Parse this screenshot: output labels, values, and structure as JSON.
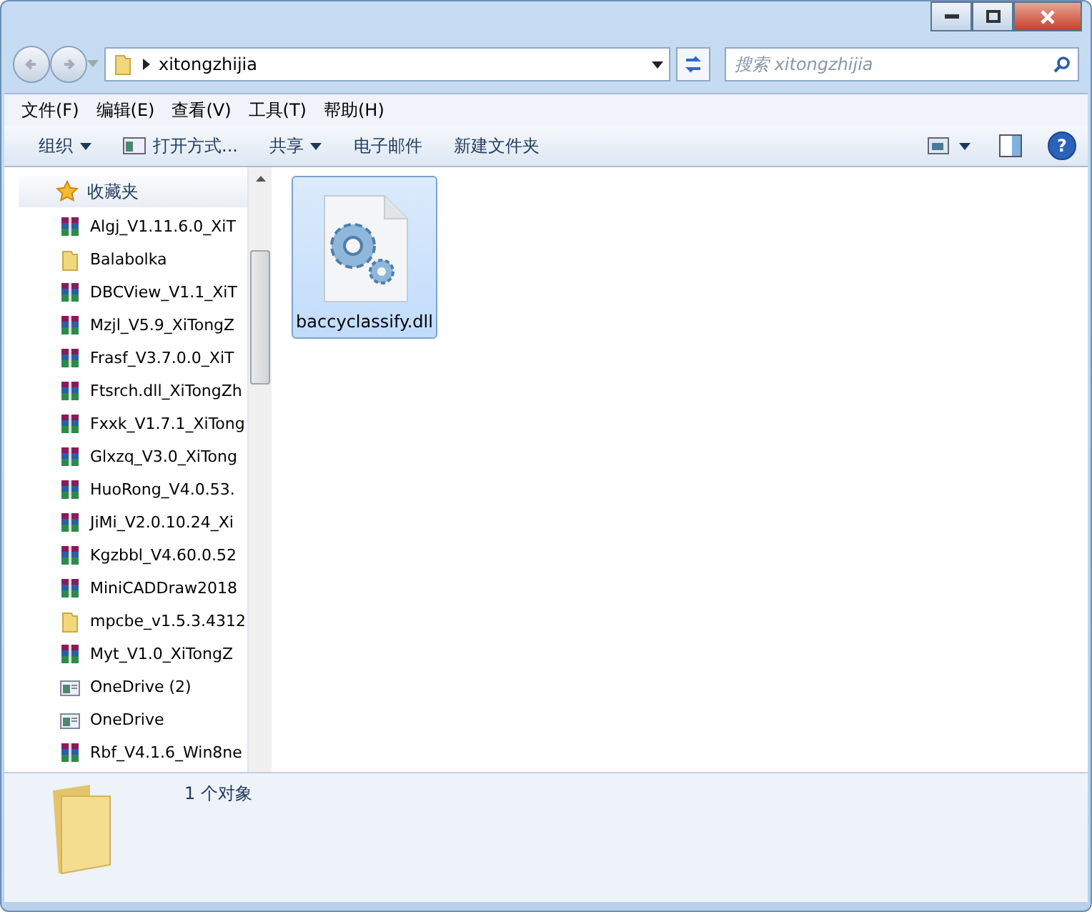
{
  "address_bar": {
    "path": "xitongzhijia"
  },
  "search": {
    "placeholder": "搜索 xitongzhijia"
  },
  "menu_bar": [
    "文件(F)",
    "编辑(E)",
    "查看(V)",
    "工具(T)",
    "帮助(H)"
  ],
  "toolbar": [
    {
      "label": "组织",
      "kind": "dropdown"
    },
    {
      "label": "打开方式...",
      "kind": "icon"
    },
    {
      "label": "共享",
      "kind": "dropdown"
    },
    {
      "label": "电子邮件",
      "kind": "plain"
    },
    {
      "label": "新建文件夹",
      "kind": "plain"
    }
  ],
  "sidebar": {
    "header": "收藏夹",
    "items": [
      {
        "label": "Algj_V1.11.6.0_XiT",
        "kind": "archive"
      },
      {
        "label": "Balabolka",
        "kind": "folder"
      },
      {
        "label": "DBCView_V1.1_XiT",
        "kind": "archive"
      },
      {
        "label": "Mzjl_V5.9_XiTongZ",
        "kind": "archive"
      },
      {
        "label": "Frasf_V3.7.0.0_XiT",
        "kind": "archive"
      },
      {
        "label": "Ftsrch.dll_XiTongZh",
        "kind": "archive"
      },
      {
        "label": "Fxxk_V1.7.1_XiTong",
        "kind": "archive"
      },
      {
        "label": "Glxzq_V3.0_XiTong",
        "kind": "archive"
      },
      {
        "label": "HuoRong_V4.0.53.",
        "kind": "archive"
      },
      {
        "label": "JiMi_V2.0.10.24_Xi",
        "kind": "archive"
      },
      {
        "label": "Kgzbbl_V4.60.0.52",
        "kind": "archive"
      },
      {
        "label": "MiniCADDraw2018",
        "kind": "archive"
      },
      {
        "label": "mpcbe_v1.5.3.4312",
        "kind": "folder"
      },
      {
        "label": "Myt_V1.0_XiTongZ",
        "kind": "archive"
      },
      {
        "label": "OneDrive (2)",
        "kind": "window"
      },
      {
        "label": "OneDrive",
        "kind": "window"
      },
      {
        "label": "Rbf_V4.1.6_Win8ne",
        "kind": "archive"
      }
    ]
  },
  "files": [
    {
      "name": "baccyclassify.dll",
      "selected": true
    }
  ],
  "details_pane": {
    "summary": "1 个对象"
  },
  "help_button": "?"
}
